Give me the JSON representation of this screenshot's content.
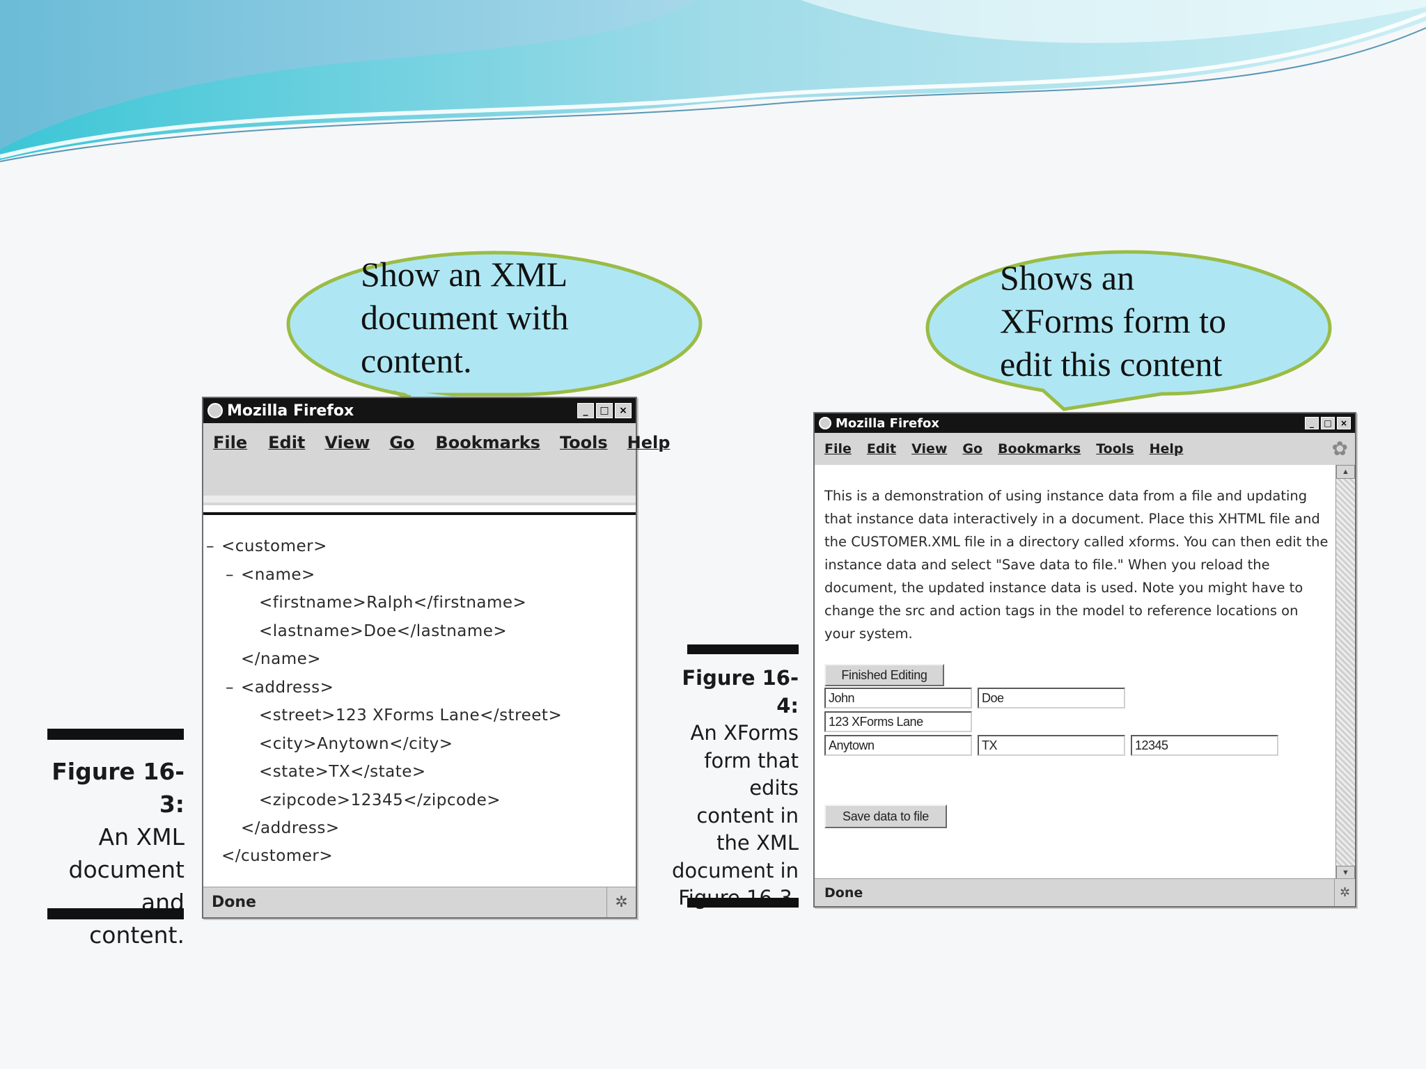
{
  "callout_left": {
    "text": "Show an XML\ndocument with\ncontent."
  },
  "callout_right": {
    "text": "Shows an\nXForms form to\nedit this content"
  },
  "figure_left": {
    "label": "Figure 16-3:",
    "lines": [
      "An XML",
      "document",
      "and content."
    ]
  },
  "figure_right": {
    "label": "Figure 16-4:",
    "lines": [
      "An XForms",
      "form that",
      "edits",
      "content in",
      "the XML",
      "document in",
      "Figure 16-3."
    ]
  },
  "browser_left": {
    "title": "Mozilla Firefox",
    "menu": [
      "File",
      "Edit",
      "View",
      "Go",
      "Bookmarks",
      "Tools",
      "Help"
    ],
    "xml_lines": [
      {
        "toggle": "–",
        "text": "<customer>"
      },
      {
        "toggle": "–",
        "text": "<name>"
      },
      {
        "toggle": "",
        "text": "<firstname>Ralph</firstname>"
      },
      {
        "toggle": "",
        "text": "<lastname>Doe</lastname>"
      },
      {
        "toggle": "",
        "text": "</name>"
      },
      {
        "toggle": "–",
        "text": "<address>"
      },
      {
        "toggle": "",
        "text": "<street>123 XForms Lane</street>"
      },
      {
        "toggle": "",
        "text": "<city>Anytown</city>"
      },
      {
        "toggle": "",
        "text": "<state>TX</state>"
      },
      {
        "toggle": "",
        "text": "<zipcode>12345</zipcode>"
      },
      {
        "toggle": "",
        "text": "</address>"
      },
      {
        "toggle": "",
        "text": "</customer>"
      }
    ],
    "status": "Done"
  },
  "browser_right": {
    "title": "Mozilla Firefox",
    "menu": [
      "File",
      "Edit",
      "View",
      "Go",
      "Bookmarks",
      "Tools",
      "Help"
    ],
    "description": "This is a demonstration of using instance data from a file and updating that instance data interactively in a document. Place this XHTML file and the CUSTOMER.XML file in a directory called xforms. You can then edit the instance data and select \"Save data to file.\" When you reload the document, the updated instance data is used. Note you might have to change the src and action tags in the model to reference locations on your system.",
    "finished_button": "Finished Editing",
    "fields": {
      "firstname": "John",
      "lastname": "Doe",
      "street": "123 XForms Lane",
      "city": "Anytown",
      "state": "TX",
      "zipcode": "12345"
    },
    "save_button": "Save data to file",
    "status": "Done"
  }
}
